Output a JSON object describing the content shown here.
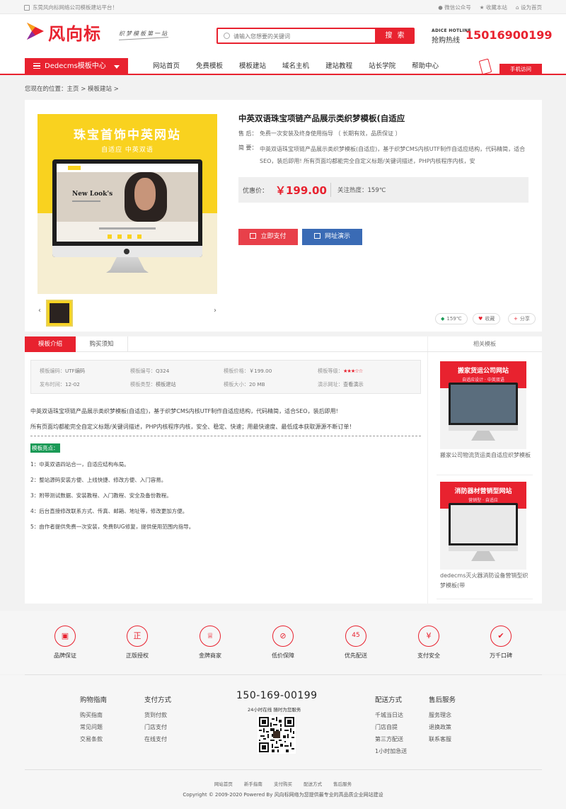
{
  "topbar": {
    "site_name": "东莞风向标网络公司模板建站平台！",
    "wechat": "微信公众号",
    "favorite": "收藏本站",
    "set_home": "设为首页"
  },
  "header": {
    "logo_text": "风向标",
    "slogan": "织梦模板第一站",
    "search_placeholder": "请输入您想要的关键词",
    "search_button": "搜 索",
    "hotline_en": "ADICE HOTLINE",
    "hotline_label": "抢购热线",
    "hotline_number": "15016900199"
  },
  "nav": {
    "category_label": "Dedecms模板中心",
    "items": [
      "网站首页",
      "免费模板",
      "模板建站",
      "域名主机",
      "建站教程",
      "站长学院",
      "帮助中心"
    ],
    "mobile_label": "手机访问"
  },
  "breadcrumb": "您现在的位置：主页 > 模板建站 >",
  "product": {
    "image_title": "珠宝首饰中英网站",
    "image_subtitle": "自适应    中英双语",
    "screen_heading": "New Look's",
    "title": "中英双语珠宝项链产品展示类织梦模板(自适应",
    "after_sales_label": "售 后：",
    "after_sales": "免费一次安装及终身使用指导 （ 长期有效，品质保证 ）",
    "summary_label": "简 要：",
    "summary": "中英双语珠宝项链产品展示类织梦模板(自适应)，基于织梦CMS内核UTF制作自适应结构，代码精简，适合SEO，装后即用! 所有页面均都能完全自定义标题/关键词描述，PHP内核程序内核，安",
    "price_label": "优惠价：",
    "price": "￥199.00",
    "heat_label": "关注热度：159℃",
    "buy_button": "立即支付",
    "demo_button": "网址演示",
    "chip_views": "159℃",
    "chip_fav": "收藏",
    "chip_share": "分享",
    "prev": "‹",
    "next": "›"
  },
  "tabs": {
    "intro": "模板介绍",
    "notice": "购买须知",
    "related": "相关模板"
  },
  "specs": {
    "r1": [
      {
        "k": "模板编码：",
        "v": "UTF编码"
      },
      {
        "k": "模板编号：",
        "v": "Q324"
      },
      {
        "k": "模板价格：",
        "v": "￥199.00"
      },
      {
        "k": "模板等级：",
        "v": "★★★☆☆"
      }
    ],
    "r2": [
      {
        "k": "发布时间：",
        "v": "12-02"
      },
      {
        "k": "模板类型：",
        "v": "模板建站"
      },
      {
        "k": "模板大小：",
        "v": "20 MB"
      },
      {
        "k": "演示网址：",
        "v": "查看演示"
      }
    ]
  },
  "detail": {
    "p1": "中英双语珠宝项链产品展示类织梦模板(自适应)，基于织梦CMS内核UTF制作自适应结构，代码精简，适合SEO，装后即用!",
    "p2": "所有页面均都能完全自定义标题/关键词描述，PHP内核程序内核，安全、稳定、快速；用最快速度、最低成本获取源源不断订单！",
    "highlight": "模板亮点：",
    "points": [
      "1：中英双语四站合一，自适应结构布局。",
      "2：整站源码安装方便、上线快捷、修改方便、入门容易。",
      "3：附带测试数据、安装教程、入门教程、安全及备份教程。",
      "4：后台直接修改联系方式、传真、邮箱、地址等，修改更加方便。",
      "5：由作者提供免费一次安装，免费BUG修复，提供使用范围内指导。"
    ]
  },
  "related": [
    {
      "img_title": "搬家货运公司网站",
      "img_sub": "自适应设计 · 中英双语",
      "caption": "搬家公司物流货运类自适应织梦模板"
    },
    {
      "img_title": "消防器材营销型网站",
      "img_sub": "营销型 · 自适应",
      "caption": "dedecms灭火器消防设备营销型织梦模板(带"
    }
  ],
  "features": [
    "品牌保证",
    "正版授权",
    "金牌商家",
    "低价保障",
    "优先配送",
    "支付安全",
    "万千口碑"
  ],
  "feature_icons": [
    "gift-icon",
    "certificate-icon",
    "trophy-icon",
    "discount-icon",
    "delivery-icon",
    "yen-icon",
    "thumbs-up-icon"
  ],
  "footer": {
    "cols": [
      {
        "h": "购物指南",
        "items": [
          "购买指南",
          "常见问题",
          "交易条款"
        ]
      },
      {
        "h": "支付方式",
        "items": [
          "货到付款",
          "门店支付",
          "在线支付"
        ]
      },
      {
        "h": "配送方式",
        "items": [
          "千城当日达",
          "门店自提",
          "第三方配送",
          "1小时加急送"
        ]
      },
      {
        "h": "售后服务",
        "items": [
          "服务理念",
          "退换政策",
          "联系客服"
        ]
      }
    ],
    "phone": "150-169-00199",
    "phone_sub": "24小时在线 随时为您服务",
    "links": [
      "网站首页",
      "新手指南",
      "支付购买",
      "配送方式",
      "售后服务"
    ],
    "copyright": "Copyright © 2009-2020 Powered By 风向标网络为您提供最专业的高品质企业网站建设"
  },
  "colors": {
    "accent": "#e8222f",
    "demo_blue": "#3a6bb5",
    "highlight_green": "#1a9a56",
    "image_yellow": "#f9d21f"
  }
}
